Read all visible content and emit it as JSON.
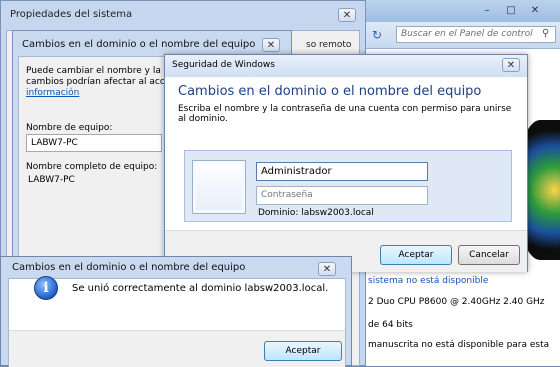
{
  "control_panel": {
    "search_placeholder": "Buscar en el Panel de control",
    "lines": [
      "sistema no está disponible",
      "2 Duo CPU     P8600 @ 2.40GHz   2.40 GHz",
      "de 64 bits",
      "manuscrita no está disponible para esta"
    ]
  },
  "system_properties": {
    "title": "Propiedades del sistema",
    "remote_label": "so remoto"
  },
  "computer_name_dialog": {
    "title": "Cambios en el dominio o el nombre del equipo",
    "intro_line1": "Puede cambiar el nombre y la pe",
    "intro_line2": "cambios podrían afectar al acces",
    "info_link": "información",
    "computer_name_label": "Nombre de equipo:",
    "computer_name_value": "LABW7-PC",
    "full_name_label": "Nombre completo de equipo:",
    "full_name_value": "LABW7-PC"
  },
  "windows_security": {
    "title": "Seguridad de Windows",
    "heading": "Cambios en el dominio o el nombre del equipo",
    "description": "Escriba el nombre y la contraseña de una cuenta con permiso para unirse al dominio.",
    "username_value": "Administrador",
    "password_placeholder": "Contraseña",
    "domain_text": "Dominio: labsw2003.local",
    "ok_button": "Aceptar",
    "cancel_button": "Cancelar"
  },
  "success_dialog": {
    "title": "Cambios en el dominio o el nombre del equipo",
    "message": "Se unió correctamente al dominio labsw2003.local.",
    "ok_button": "Aceptar"
  },
  "icons": {
    "close": "close-icon",
    "info": "info-icon",
    "refresh": "refresh-icon",
    "search": "search-icon",
    "user_tile": "user-tile-icon"
  }
}
